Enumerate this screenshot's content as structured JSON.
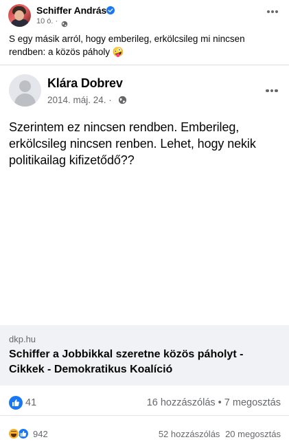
{
  "post": {
    "author": "Schiffer András",
    "time": "10 ó.",
    "separator": "·",
    "text": "S egy másik arról, hogy emberileg, erkölcsileg mi nincsen rendben: a közös páholy 🤪"
  },
  "shared_post": {
    "author": "Klára Dobrev",
    "date": "2014. máj. 24. ·",
    "text": "Szerintem ez nincsen rendben. Emberileg, erkölcsileg nincsen renben. Lehet, hogy nekik politikailag kifizetődő??",
    "link": {
      "domain": "dkp.hu",
      "title": "Schiffer a Jobbikkal szeretne közös páholyt - Cikkek - Demokratikus Koalíció"
    },
    "reactions_count": "41",
    "counts_text": "16 hozzászólás • 7 megosztás"
  },
  "outer_reactions": {
    "count": "942",
    "comments": "52 hozzászólás",
    "shares": "20 megosztás"
  },
  "colors": {
    "accent": "#1877f2",
    "secondary_text": "#65676b",
    "preview_bg": "#f0f2f5"
  },
  "icons": [
    "verified-icon",
    "globe-icon",
    "more-icon",
    "like-icon",
    "haha-icon"
  ]
}
